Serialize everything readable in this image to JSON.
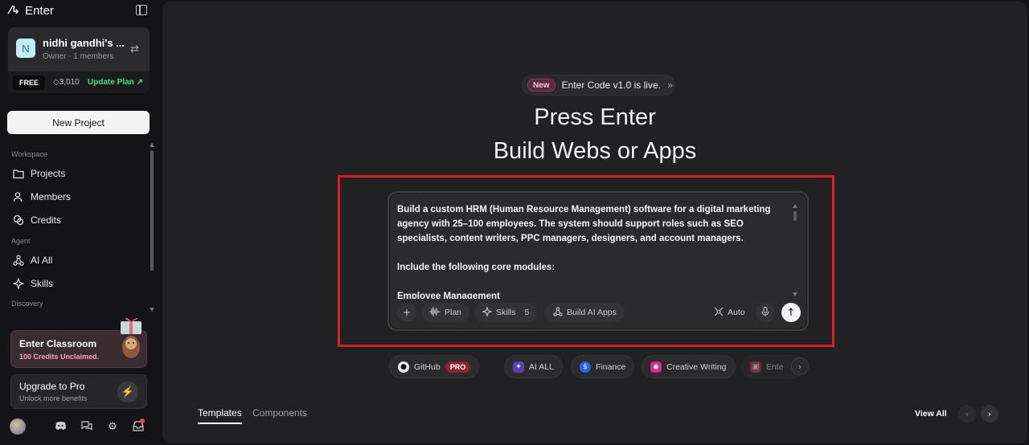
{
  "brand": {
    "name": "Enter"
  },
  "team": {
    "initial": "N",
    "name": "nidhi gandhi's ...",
    "role": "Owner · 1 members",
    "plan": "FREE",
    "credits": "3,010",
    "update_label": "Update Plan ↗"
  },
  "sidebar": {
    "new_project": "New Project",
    "workspace_label": "Workspace",
    "workspace_items": [
      {
        "label": "Projects",
        "icon": "folder-icon"
      },
      {
        "label": "Members",
        "icon": "users-icon"
      },
      {
        "label": "Credits",
        "icon": "coins-icon"
      }
    ],
    "agent_label": "Agent",
    "agent_items": [
      {
        "label": "AI All",
        "icon": "nodes-icon"
      },
      {
        "label": "Skills",
        "icon": "sparkle-icon"
      }
    ],
    "discovery_label": "Discovery",
    "classroom": {
      "title": "Enter Classroom",
      "subtitle": "100 Credits Unclaimed."
    },
    "upgrade": {
      "title": "Upgrade to Pro",
      "subtitle": "Unlock more benefits"
    }
  },
  "main": {
    "announce": {
      "badge": "New",
      "text": "Enter Code v1.0 is live."
    },
    "hero_line1": "Press Enter",
    "hero_line2": "Build Webs or Apps",
    "prompt_text": "Build a custom HRM (Human Resource Management) software for a digital marketing agency with 25–100 employees. The system should support roles such as SEO specialists, content writers, PPC managers, designers, and account managers.\n\nInclude the following core modules:\n\nEmployee Management",
    "toolbar": {
      "plan": "Plan",
      "skills": "Skills",
      "skills_count": "5",
      "build_ai_apps": "Build AI Apps",
      "auto": "Auto"
    },
    "chips": [
      {
        "label": "GitHub",
        "badge": "PRO"
      },
      {
        "label": "AI ALL"
      },
      {
        "label": "Finance"
      },
      {
        "label": "Creative Writing"
      },
      {
        "label": "Ente"
      }
    ],
    "tabs": {
      "templates": "Templates",
      "components": "Components"
    },
    "view_all": "View All"
  },
  "colors": {
    "accent_green": "#4ade80",
    "highlight_red": "#d61f26",
    "classroom_pink": "#f6a0c4",
    "pro_red": "#8f2430"
  }
}
